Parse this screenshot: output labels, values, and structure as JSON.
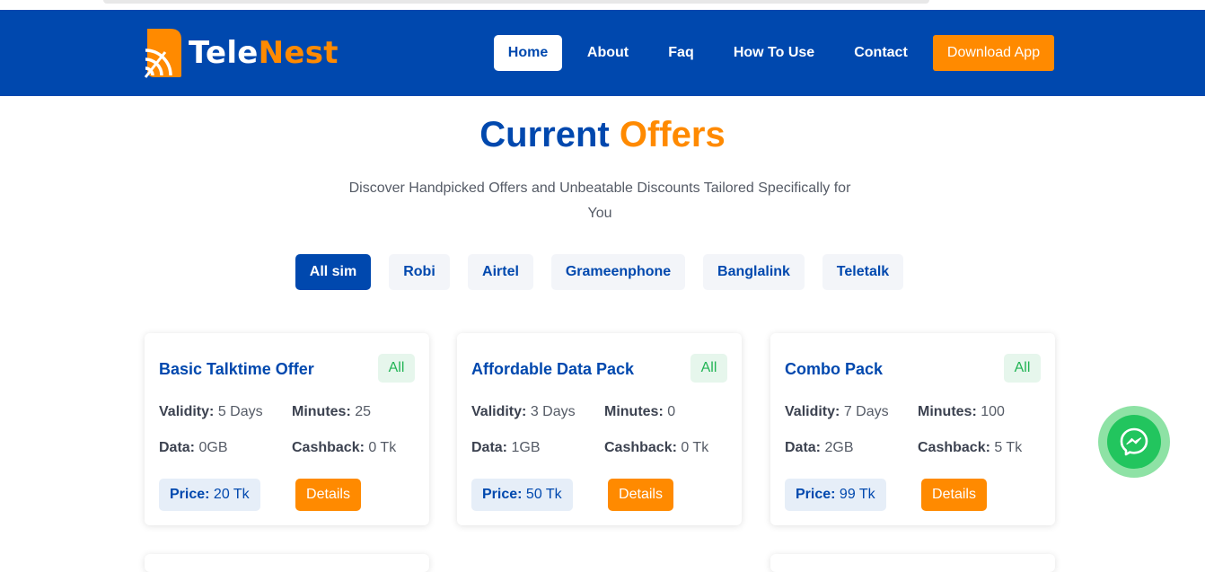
{
  "brand": {
    "name_part1": "Tele",
    "name_part2": "Nest",
    "primary_color": "#0048ae",
    "accent_color": "#ff8a00"
  },
  "nav": {
    "items": [
      {
        "label": "Home",
        "active": true
      },
      {
        "label": "About",
        "active": false
      },
      {
        "label": "Faq",
        "active": false
      },
      {
        "label": "How To Use",
        "active": false
      },
      {
        "label": "Contact",
        "active": false
      }
    ],
    "download_label": "Download App"
  },
  "hero": {
    "title_part1": "Current",
    "title_part2": "Offers",
    "subtitle": "Discover Handpicked Offers and Unbeatable Discounts Tailored Specifically for You"
  },
  "filters": [
    {
      "label": "All sim",
      "active": true
    },
    {
      "label": "Robi",
      "active": false
    },
    {
      "label": "Airtel",
      "active": false
    },
    {
      "label": "Grameenphone",
      "active": false
    },
    {
      "label": "Banglalink",
      "active": false
    },
    {
      "label": "Teletalk",
      "active": false
    }
  ],
  "offers": [
    {
      "title": "Basic Talktime Offer",
      "badge": "All",
      "validity_label": "Validity:",
      "validity": "5 Days",
      "minutes_label": "Minutes:",
      "minutes": "25",
      "data_label": "Data:",
      "data": "0GB",
      "cashback_label": "Cashback:",
      "cashback": "0 Tk",
      "price_label": "Price:",
      "price": "20 Tk",
      "details_label": "Details"
    },
    {
      "title": "Affordable Data Pack",
      "badge": "All",
      "validity_label": "Validity:",
      "validity": "3 Days",
      "minutes_label": "Minutes:",
      "minutes": "0",
      "data_label": "Data:",
      "data": "1GB",
      "cashback_label": "Cashback:",
      "cashback": "0 Tk",
      "price_label": "Price:",
      "price": "50 Tk",
      "details_label": "Details"
    },
    {
      "title": "Combo Pack",
      "badge": "All",
      "validity_label": "Validity:",
      "validity": "7 Days",
      "minutes_label": "Minutes:",
      "minutes": "100",
      "data_label": "Data:",
      "data": "2GB",
      "cashback_label": "Cashback:",
      "cashback": "5 Tk",
      "price_label": "Price:",
      "price": "99 Tk",
      "details_label": "Details"
    }
  ],
  "chat_widget": {
    "icon": "messenger-icon"
  }
}
